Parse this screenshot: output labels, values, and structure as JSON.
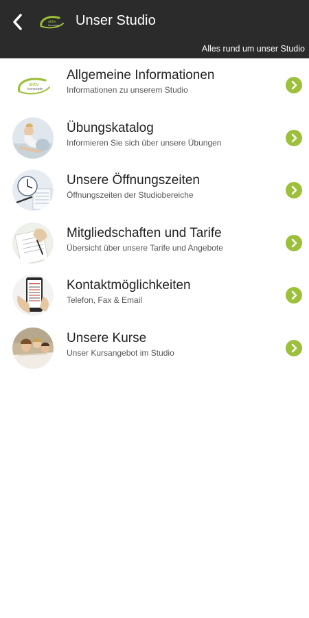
{
  "header": {
    "title": "Unser Studio",
    "subtitle": "Alles rund um unser Studio",
    "logo_text": "aktiv konzepte",
    "background": "#2b2b2b"
  },
  "accent_color": "#9cc03a",
  "items": [
    {
      "title": "Allgemeine Informationen",
      "subtitle": "Informationen zu unserem Studio",
      "icon": "studio-logo-icon"
    },
    {
      "title": "Übungskatalog",
      "subtitle": "Informieren Sie sich über unsere Übungen",
      "icon": "exercise-photo-icon"
    },
    {
      "title": "Unsere Öffnungszeiten",
      "subtitle": "Öffnungszeiten der Studiobereiche",
      "icon": "clock-photo-icon"
    },
    {
      "title": "Mitgliedschaften und Tarife",
      "subtitle": "Übersicht über unsere Tarife und Angebote",
      "icon": "contract-photo-icon"
    },
    {
      "title": "Kontaktmöglichkeiten",
      "subtitle": "Telefon, Fax & Email",
      "icon": "phone-photo-icon"
    },
    {
      "title": "Unsere Kurse",
      "subtitle": "Unser Kursangebot im Studio",
      "icon": "course-photo-icon"
    }
  ]
}
